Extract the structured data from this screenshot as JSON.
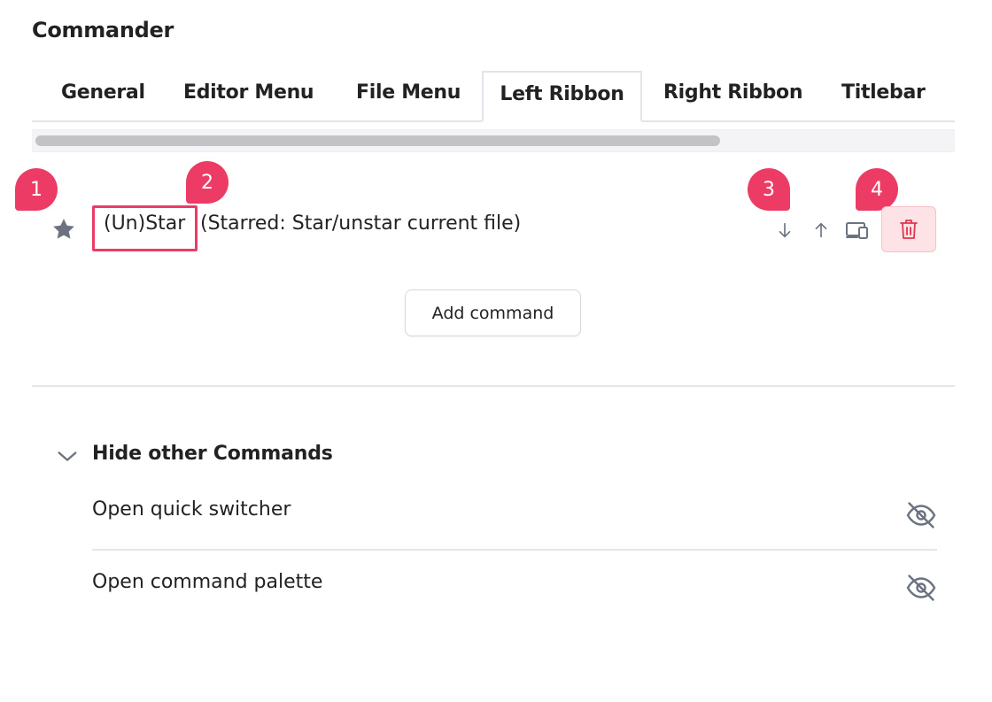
{
  "header": {
    "title": "Commander"
  },
  "tabs": [
    {
      "label": "General"
    },
    {
      "label": "Editor Menu"
    },
    {
      "label": "File Menu"
    },
    {
      "label": "Left Ribbon",
      "active": true
    },
    {
      "label": "Right Ribbon"
    },
    {
      "label": "Titlebar"
    }
  ],
  "badges": [
    "1",
    "2",
    "3",
    "4"
  ],
  "command": {
    "icon": "star-icon",
    "name": "(Un)Star",
    "description": "(Starred: Star/unstar current file)",
    "controls": [
      "arrow-down-icon",
      "arrow-up-icon",
      "device-icon",
      "trash-icon"
    ]
  },
  "add_button": {
    "label": "Add command"
  },
  "hide_section": {
    "title": "Hide other Commands",
    "items": [
      {
        "label": "Open quick switcher",
        "icon": "eye-off-icon"
      },
      {
        "label": "Open command palette",
        "icon": "eye-off-icon"
      }
    ]
  },
  "colors": {
    "accent": "#ec3c66",
    "danger_bg": "#fde3e6",
    "icon": "#6b7280"
  }
}
